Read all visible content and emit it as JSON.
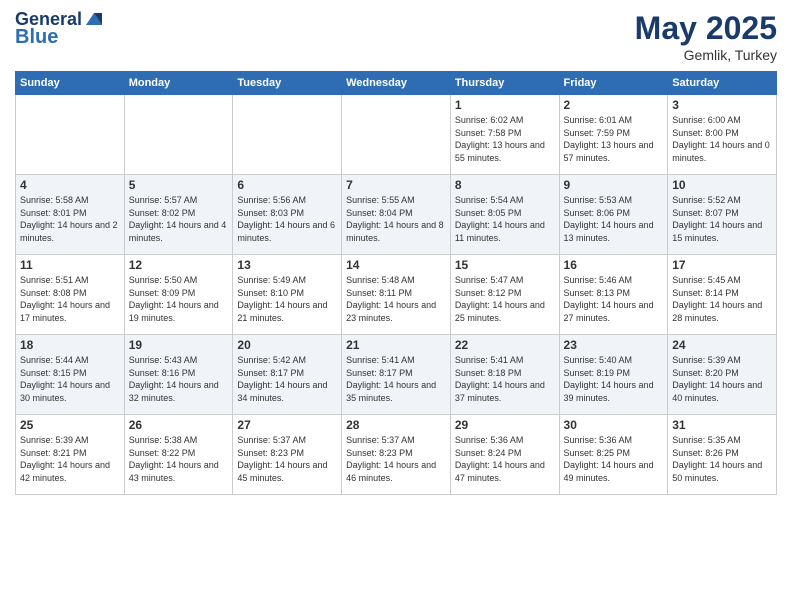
{
  "header": {
    "logo_line1": "General",
    "logo_line2": "Blue",
    "month": "May 2025",
    "location": "Gemlik, Turkey"
  },
  "weekdays": [
    "Sunday",
    "Monday",
    "Tuesday",
    "Wednesday",
    "Thursday",
    "Friday",
    "Saturday"
  ],
  "weeks": [
    [
      {
        "day": "",
        "info": ""
      },
      {
        "day": "",
        "info": ""
      },
      {
        "day": "",
        "info": ""
      },
      {
        "day": "",
        "info": ""
      },
      {
        "day": "1",
        "info": "Sunrise: 6:02 AM\nSunset: 7:58 PM\nDaylight: 13 hours and 55 minutes."
      },
      {
        "day": "2",
        "info": "Sunrise: 6:01 AM\nSunset: 7:59 PM\nDaylight: 13 hours and 57 minutes."
      },
      {
        "day": "3",
        "info": "Sunrise: 6:00 AM\nSunset: 8:00 PM\nDaylight: 14 hours and 0 minutes."
      }
    ],
    [
      {
        "day": "4",
        "info": "Sunrise: 5:58 AM\nSunset: 8:01 PM\nDaylight: 14 hours and 2 minutes."
      },
      {
        "day": "5",
        "info": "Sunrise: 5:57 AM\nSunset: 8:02 PM\nDaylight: 14 hours and 4 minutes."
      },
      {
        "day": "6",
        "info": "Sunrise: 5:56 AM\nSunset: 8:03 PM\nDaylight: 14 hours and 6 minutes."
      },
      {
        "day": "7",
        "info": "Sunrise: 5:55 AM\nSunset: 8:04 PM\nDaylight: 14 hours and 8 minutes."
      },
      {
        "day": "8",
        "info": "Sunrise: 5:54 AM\nSunset: 8:05 PM\nDaylight: 14 hours and 11 minutes."
      },
      {
        "day": "9",
        "info": "Sunrise: 5:53 AM\nSunset: 8:06 PM\nDaylight: 14 hours and 13 minutes."
      },
      {
        "day": "10",
        "info": "Sunrise: 5:52 AM\nSunset: 8:07 PM\nDaylight: 14 hours and 15 minutes."
      }
    ],
    [
      {
        "day": "11",
        "info": "Sunrise: 5:51 AM\nSunset: 8:08 PM\nDaylight: 14 hours and 17 minutes."
      },
      {
        "day": "12",
        "info": "Sunrise: 5:50 AM\nSunset: 8:09 PM\nDaylight: 14 hours and 19 minutes."
      },
      {
        "day": "13",
        "info": "Sunrise: 5:49 AM\nSunset: 8:10 PM\nDaylight: 14 hours and 21 minutes."
      },
      {
        "day": "14",
        "info": "Sunrise: 5:48 AM\nSunset: 8:11 PM\nDaylight: 14 hours and 23 minutes."
      },
      {
        "day": "15",
        "info": "Sunrise: 5:47 AM\nSunset: 8:12 PM\nDaylight: 14 hours and 25 minutes."
      },
      {
        "day": "16",
        "info": "Sunrise: 5:46 AM\nSunset: 8:13 PM\nDaylight: 14 hours and 27 minutes."
      },
      {
        "day": "17",
        "info": "Sunrise: 5:45 AM\nSunset: 8:14 PM\nDaylight: 14 hours and 28 minutes."
      }
    ],
    [
      {
        "day": "18",
        "info": "Sunrise: 5:44 AM\nSunset: 8:15 PM\nDaylight: 14 hours and 30 minutes."
      },
      {
        "day": "19",
        "info": "Sunrise: 5:43 AM\nSunset: 8:16 PM\nDaylight: 14 hours and 32 minutes."
      },
      {
        "day": "20",
        "info": "Sunrise: 5:42 AM\nSunset: 8:17 PM\nDaylight: 14 hours and 34 minutes."
      },
      {
        "day": "21",
        "info": "Sunrise: 5:41 AM\nSunset: 8:17 PM\nDaylight: 14 hours and 35 minutes."
      },
      {
        "day": "22",
        "info": "Sunrise: 5:41 AM\nSunset: 8:18 PM\nDaylight: 14 hours and 37 minutes."
      },
      {
        "day": "23",
        "info": "Sunrise: 5:40 AM\nSunset: 8:19 PM\nDaylight: 14 hours and 39 minutes."
      },
      {
        "day": "24",
        "info": "Sunrise: 5:39 AM\nSunset: 8:20 PM\nDaylight: 14 hours and 40 minutes."
      }
    ],
    [
      {
        "day": "25",
        "info": "Sunrise: 5:39 AM\nSunset: 8:21 PM\nDaylight: 14 hours and 42 minutes."
      },
      {
        "day": "26",
        "info": "Sunrise: 5:38 AM\nSunset: 8:22 PM\nDaylight: 14 hours and 43 minutes."
      },
      {
        "day": "27",
        "info": "Sunrise: 5:37 AM\nSunset: 8:23 PM\nDaylight: 14 hours and 45 minutes."
      },
      {
        "day": "28",
        "info": "Sunrise: 5:37 AM\nSunset: 8:23 PM\nDaylight: 14 hours and 46 minutes."
      },
      {
        "day": "29",
        "info": "Sunrise: 5:36 AM\nSunset: 8:24 PM\nDaylight: 14 hours and 47 minutes."
      },
      {
        "day": "30",
        "info": "Sunrise: 5:36 AM\nSunset: 8:25 PM\nDaylight: 14 hours and 49 minutes."
      },
      {
        "day": "31",
        "info": "Sunrise: 5:35 AM\nSunset: 8:26 PM\nDaylight: 14 hours and 50 minutes."
      }
    ]
  ]
}
